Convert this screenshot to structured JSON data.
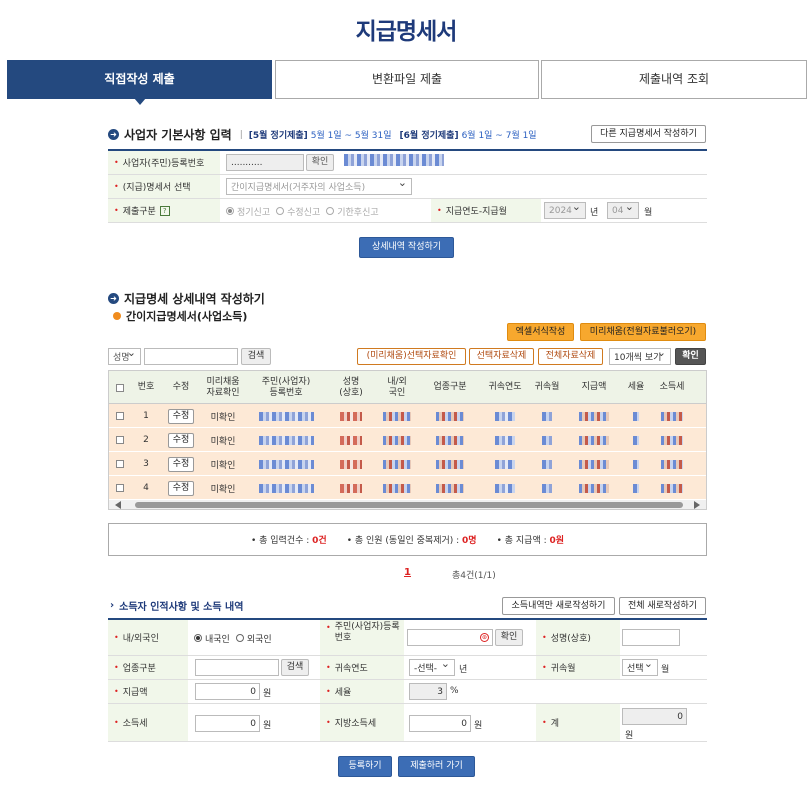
{
  "page": {
    "title": "지급명세서"
  },
  "tabs": [
    {
      "label": "직접작성 제출"
    },
    {
      "label": "변환파일 제출"
    },
    {
      "label": "제출내역 조회"
    }
  ],
  "basic": {
    "title": "사업자 기본사항 입력",
    "period1_label": "[5월 정기제출]",
    "period1_range": "5월 1일 ~ 5월 31일",
    "period2_label": "[6월 정기제출]",
    "period2_range": "6월 1일 ~ 7월 1일",
    "other_button": "다른 지급명세서 작성하기",
    "biz_no_label": "사업자(주민)등록번호",
    "biz_no_value": "...........",
    "confirm_button": "확인",
    "type_label": "(지급)명세서 선택",
    "type_value": "간이지급명세서(거주자의 사업소득)",
    "submit_label": "제출구분",
    "help": "?",
    "submit_options": [
      "정기신고",
      "수정신고",
      "기한후신고"
    ],
    "year_label": "지급연도-지급월",
    "year_value": "2024",
    "year_unit": "년",
    "month_value": "04",
    "month_unit": "월",
    "detail_button": "상세내역 작성하기"
  },
  "detail": {
    "title": "지급명세 상세내역 작성하기",
    "subtitle": "간이지급명세서(사업소득)",
    "excel_button": "엑셀서식작성",
    "prefill_button": "미리채움(전월자료불러오기)",
    "filter_select": "성명",
    "search_button": "검색",
    "prefill_confirm_button": "(미리채움)선택자료확인",
    "delete_selected_button": "선택자료삭제",
    "delete_all_button": "전체자료삭제",
    "page_size": "10개씩 보기",
    "ok_button": "확인",
    "columns": [
      "번호",
      "수정",
      "미리채움\n자료확인",
      "주민(사업자)\n등록번호",
      "성명\n(상호)",
      "내/외\n국인",
      "업종구분",
      "귀속연도",
      "귀속월",
      "지급액",
      "세율",
      "소득세"
    ],
    "rows": [
      {
        "no": "1",
        "edit": "수정",
        "status": "미확인"
      },
      {
        "no": "2",
        "edit": "수정",
        "status": "미확인"
      },
      {
        "no": "3",
        "edit": "수정",
        "status": "미확인"
      },
      {
        "no": "4",
        "edit": "수정",
        "status": "미확인"
      }
    ],
    "summary": {
      "count_label": "총 입력건수 : ",
      "count": "0건",
      "people_label": "총 인원 (동일인 중복제거) : ",
      "people": "0명",
      "amount_label": "총 지급액 : ",
      "amount": "0원"
    },
    "page_no": "1",
    "total": "총4건(1/1)"
  },
  "income": {
    "title": "소득자 인적사항 및 소득 내역",
    "new_income_button": "소득내역만 새로작성하기",
    "new_all_button": "전체 새로작성하기",
    "nation_label": "내/외국인",
    "nation_options": [
      "내국인",
      "외국인"
    ],
    "id_label": "주민(사업자)등록번호",
    "id_confirm": "확인",
    "name_label": "성명(상호)",
    "biz_label": "업종구분",
    "biz_search": "검색",
    "year_label": "귀속연도",
    "year_value": "-선택-",
    "year_unit": "년",
    "month_label": "귀속월",
    "month_value": "선택",
    "month_unit": "월",
    "pay_label": "지급액",
    "pay_value": "0",
    "won": "원",
    "rate_label": "세율",
    "rate_value": "3",
    "pct": "%",
    "tax_label": "소득세",
    "tax_value": "0",
    "local_label": "지방소득세",
    "local_value": "0",
    "total_label": "계",
    "total_value": "0"
  },
  "footer": {
    "register_button": "등록하기",
    "submit_button": "제출하러 가기"
  }
}
